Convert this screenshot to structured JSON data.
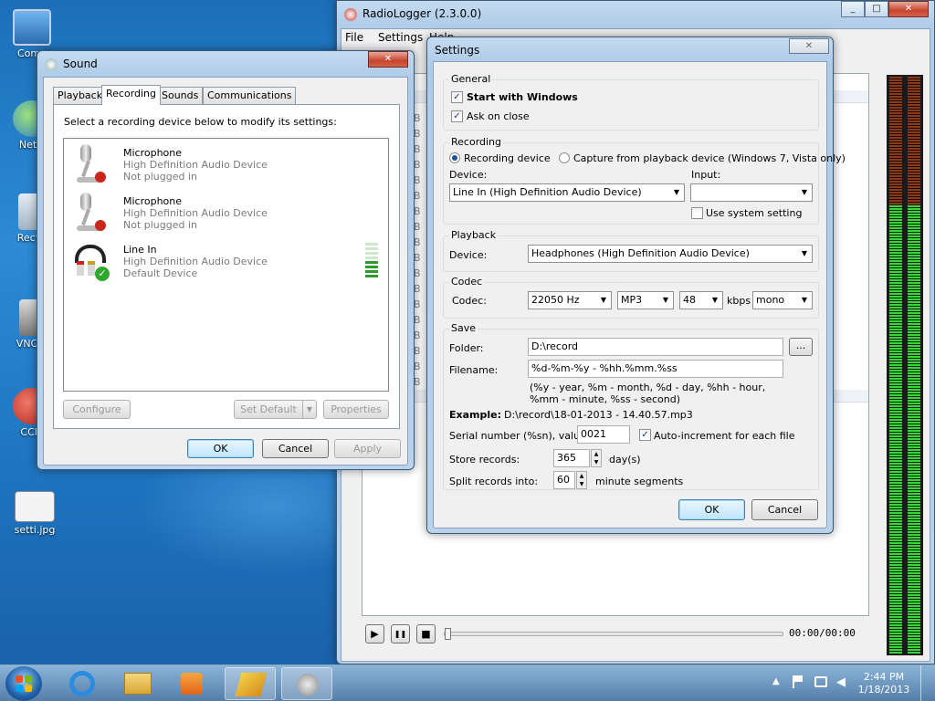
{
  "desktop": {
    "icons": [
      {
        "label": "Comp"
      },
      {
        "label": "Netw"
      },
      {
        "label": "Recyc"
      },
      {
        "label": "VNC-5"
      },
      {
        "label": "CCle"
      },
      {
        "label": "setti.jpg"
      }
    ]
  },
  "radiologger": {
    "title": "RadioLogger (2.3.0.0)",
    "menu": [
      "File",
      "Settings",
      "Help"
    ],
    "list_glyph": "B",
    "time": "00:00/00:00",
    "controls": {
      "play": "▶",
      "pause": "❚❚",
      "stop": "■"
    }
  },
  "sound": {
    "title": "Sound",
    "tabs": [
      "Playback",
      "Recording",
      "Sounds",
      "Communications"
    ],
    "active_tab": "Recording",
    "instruction": "Select a recording device below to modify its settings:",
    "devices": [
      {
        "name": "Microphone",
        "driver": "High Definition Audio Device",
        "status": "Not plugged in"
      },
      {
        "name": "Microphone",
        "driver": "High Definition Audio Device",
        "status": "Not plugged in"
      },
      {
        "name": "Line In",
        "driver": "High Definition Audio Device",
        "status": "Default Device"
      }
    ],
    "buttons": {
      "configure": "Configure",
      "set_default": "Set Default",
      "properties": "Properties",
      "ok": "OK",
      "cancel": "Cancel",
      "apply": "Apply"
    }
  },
  "settings": {
    "title": "Settings",
    "general": {
      "label": "General",
      "start_with_windows": "Start with Windows",
      "start_checked": true,
      "ask_on_close": "Ask on close",
      "ask_checked": true
    },
    "recording": {
      "label": "Recording",
      "radio_device": "Recording device",
      "radio_capture": "Capture from playback device (Windows 7, Vista only)",
      "device_label": "Device:",
      "device_value": "Line In (High Definition Audio Device)",
      "input_label": "Input:",
      "input_value": "",
      "use_system": "Use system setting"
    },
    "playback": {
      "label": "Playback",
      "device_label": "Device:",
      "device_value": "Headphones (High Definition Audio Device)"
    },
    "codec": {
      "label": "Codec",
      "codec_label": "Codec:",
      "rate": "22050 Hz",
      "format": "MP3",
      "bitrate": "48",
      "kbps": "kbps",
      "channels": "mono"
    },
    "save": {
      "label": "Save",
      "folder_label": "Folder:",
      "folder_value": "D:\\record",
      "browse": "...",
      "filename_label": "Filename:",
      "filename_value": "%d-%m-%y - %hh.%mm.%ss",
      "hint1": "(%y - year, %m - month, %d - day, %hh - hour,",
      "hint2": "%mm - minute, %ss - second)",
      "example_label": "Example:",
      "example_value": "D:\\record\\18-01-2013 - 14.40.57.mp3",
      "serial_label": "Serial number (%sn), value:",
      "serial_value": "0021",
      "auto_increment": "Auto-increment for each file",
      "store_label": "Store records:",
      "store_value": "365",
      "store_unit": "day(s)",
      "split_label": "Split records into:",
      "split_value": "60",
      "split_unit": "minute segments"
    },
    "buttons": {
      "ok": "OK",
      "cancel": "Cancel"
    }
  },
  "taskbar": {
    "time": "2:44 PM",
    "date": "1/18/2013"
  }
}
